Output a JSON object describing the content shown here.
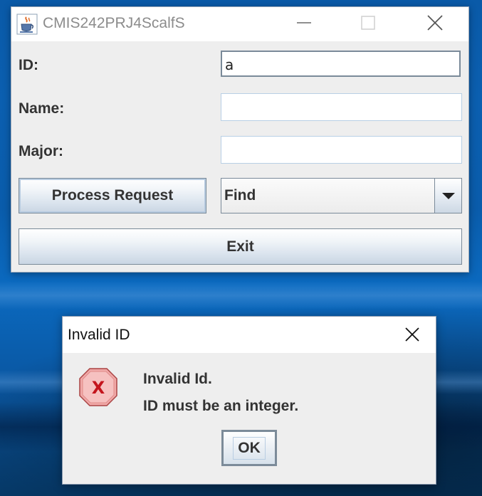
{
  "main_window": {
    "title": "CMIS242PRJ4ScalfS",
    "fields": {
      "id_label": "ID:",
      "id_value": "a",
      "name_label": "Name:",
      "name_value": "",
      "major_label": "Major:",
      "major_value": ""
    },
    "process_button": "Process Request",
    "action_select": "Find",
    "exit_button": "Exit",
    "icons": {
      "app": "java-cup-icon",
      "minimize": "minimize-icon",
      "maximize": "maximize-icon",
      "close": "close-icon",
      "dropdown": "chevron-down-icon"
    }
  },
  "dialog": {
    "title": "Invalid ID",
    "message_line1": "Invalid Id.",
    "message_line2": "ID must be an integer.",
    "ok_button": "OK",
    "icons": {
      "error": "error-icon",
      "close": "close-icon"
    },
    "error_color": "#d9534f"
  },
  "colors": {
    "desktop": "#0b5fb0",
    "window_bg": "#eeeeee",
    "field_border": "#b8cfe5"
  }
}
